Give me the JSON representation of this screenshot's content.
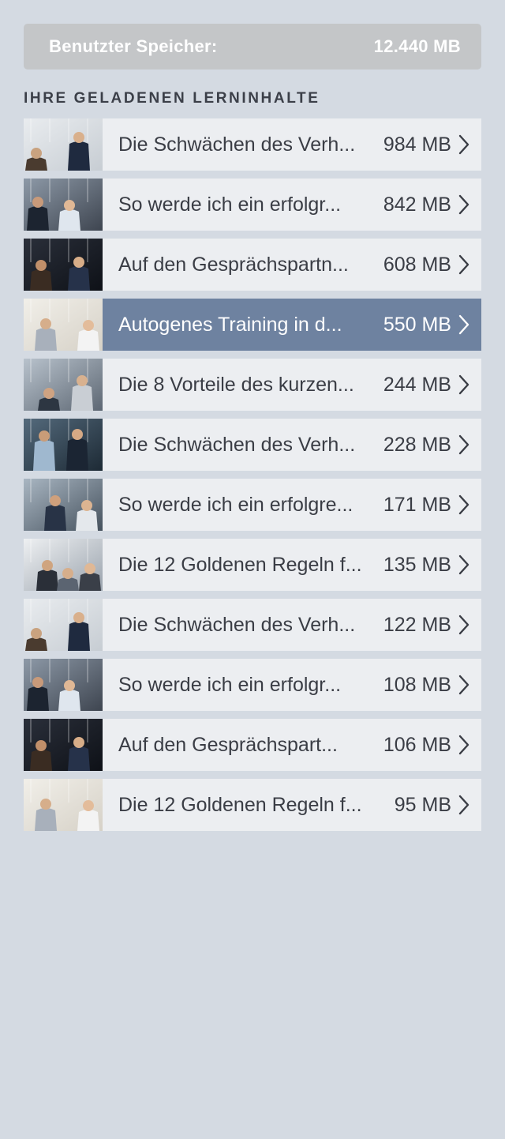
{
  "storage": {
    "label": "Benutzter Speicher:",
    "value": "12.440 MB"
  },
  "section_title": "IHRE GELADENEN LERNINHALTE",
  "items": [
    {
      "title": "Die Schwächen des Verh...",
      "size": "984 MB",
      "thumb": "scene-a",
      "selected": false
    },
    {
      "title": "So werde ich ein erfolgr...",
      "size": "842 MB",
      "thumb": "scene-b",
      "selected": false
    },
    {
      "title": "Auf den Gesprächspartn...",
      "size": "608 MB",
      "thumb": "scene-c",
      "selected": false
    },
    {
      "title": "Autogenes Training in d...",
      "size": "550 MB",
      "thumb": "scene-d",
      "selected": true
    },
    {
      "title": "Die 8 Vorteile des kurzen...",
      "size": "244 MB",
      "thumb": "scene-e",
      "selected": false
    },
    {
      "title": "Die Schwächen des Verh...",
      "size": "228 MB",
      "thumb": "scene-f",
      "selected": false
    },
    {
      "title": "So werde ich ein erfolgre...",
      "size": "171 MB",
      "thumb": "scene-g",
      "selected": false
    },
    {
      "title": "Die 12 Goldenen Regeln f...",
      "size": "135 MB",
      "thumb": "scene-h",
      "selected": false
    },
    {
      "title": "Die Schwächen des Verh...",
      "size": "122 MB",
      "thumb": "scene-a",
      "selected": false
    },
    {
      "title": "So werde ich ein erfolgr...",
      "size": "108 MB",
      "thumb": "scene-b",
      "selected": false
    },
    {
      "title": "Auf den Gesprächspart...",
      "size": "106 MB",
      "thumb": "scene-c",
      "selected": false
    },
    {
      "title": "Die 12 Goldenen Regeln f...",
      "size": "95 MB",
      "thumb": "scene-d",
      "selected": false
    }
  ],
  "colors": {
    "background": "#d4dae2",
    "row": "#eceef1",
    "selected_row": "#6e82a0",
    "text": "#3a3d45",
    "storage_bar": "#c4c6c8"
  },
  "icons": {
    "row_chevron": "chevron-right-icon"
  }
}
